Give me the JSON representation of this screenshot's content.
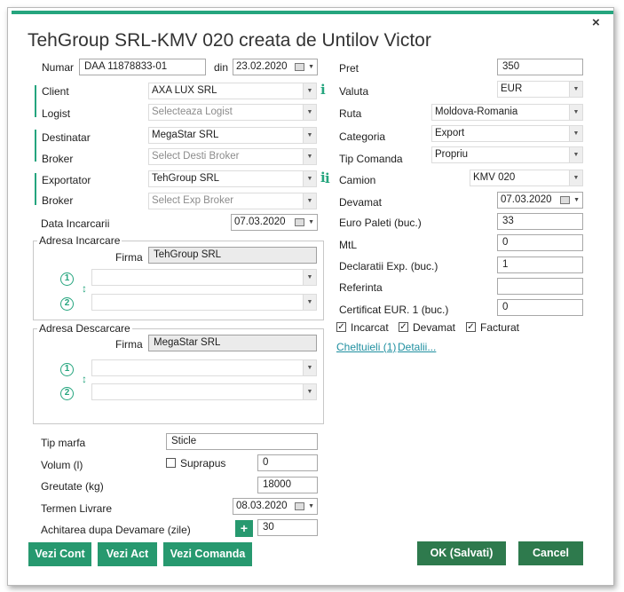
{
  "window": {
    "title": "TehGroup SRL-KMV 020 creata de Untilov Victor",
    "close_icon": "×",
    "accent_color": "#25a57e"
  },
  "left": {
    "numar_label": "Numar",
    "numar_value": "DAA 11878833-01",
    "din_label": "din",
    "din_value": "23.02.2020",
    "client_label": "Client",
    "client_value": "AXA LUX SRL",
    "logist_label": "Logist",
    "logist_placeholder": "Selecteaza  Logist",
    "destinatar_label": "Destinatar",
    "destinatar_value": "MegaStar SRL",
    "broker1_label": "Broker",
    "broker1_placeholder": "Select Desti Broker",
    "exportator_label": "Exportator",
    "exportator_value": "TehGroup SRL",
    "broker2_label": "Broker",
    "broker2_placeholder": "Select Exp Broker",
    "data_incarcarii_label": "Data Incarcarii",
    "data_incarcarii_value": "07.03.2020",
    "adresa_incarcare": {
      "title": "Adresa Incarcare",
      "firma_label": "Firma",
      "firma_value": "TehGroup SRL",
      "num1": "1",
      "num2": "2"
    },
    "adresa_descarcare": {
      "title": "Adresa Descarcare",
      "firma_label": "Firma",
      "firma_value": "MegaStar SRL",
      "num1": "1",
      "num2": "2"
    },
    "tip_marfa_label": "Tip marfa",
    "tip_marfa_value": "Sticle",
    "volum_label": "Volum (l)",
    "suprapus_label": "Suprapus",
    "volum_value": "0",
    "greutate_label": "Greutate (kg)",
    "greutate_value": "18000",
    "termen_label": "Termen Livrare",
    "termen_value": "08.03.2020",
    "achitarea_label": "Achitarea dupa Devamare (zile)",
    "achitarea_plus": "+",
    "achitarea_value": "30"
  },
  "right": {
    "pret_label": "Pret",
    "pret_value": "350",
    "valuta_label": "Valuta",
    "valuta_value": "EUR",
    "ruta_label": "Ruta",
    "ruta_value": "Moldova-Romania",
    "categoria_label": "Categoria",
    "categoria_value": "Export",
    "tip_comanda_label": "Tip Comanda",
    "tip_comanda_value": "Propriu",
    "camion_label": "Camion",
    "camion_value": "KMV 020",
    "devamat_label": "Devamat",
    "devamat_value": "07.03.2020",
    "euro_paleti_label": "Euro Paleti (buc.)",
    "euro_paleti_value": "33",
    "mtl_label": "MtL",
    "mtl_value": "0",
    "declaratii_label": "Declaratii Exp. (buc.)",
    "declaratii_value": "1",
    "referinta_label": "Referinta",
    "referinta_value": "",
    "certificat_label": "Certificat EUR. 1 (buc.)",
    "certificat_value": "0",
    "incarcat_label": "Incarcat",
    "devamat_chk_label": "Devamat",
    "facturat_label": "Facturat",
    "cheltuieli_link": "Cheltuieli (1)",
    "detalii_link": "Detalii..."
  },
  "buttons": {
    "vezi_cont": "Vezi Cont",
    "vezi_act": "Vezi Act",
    "vezi_comanda": "Vezi Comanda",
    "ok": "OK (Salvati)",
    "cancel": "Cancel"
  },
  "glyphs": {
    "dropdown": "▼",
    "check": "✓",
    "info": "i",
    "updown": "↕"
  }
}
